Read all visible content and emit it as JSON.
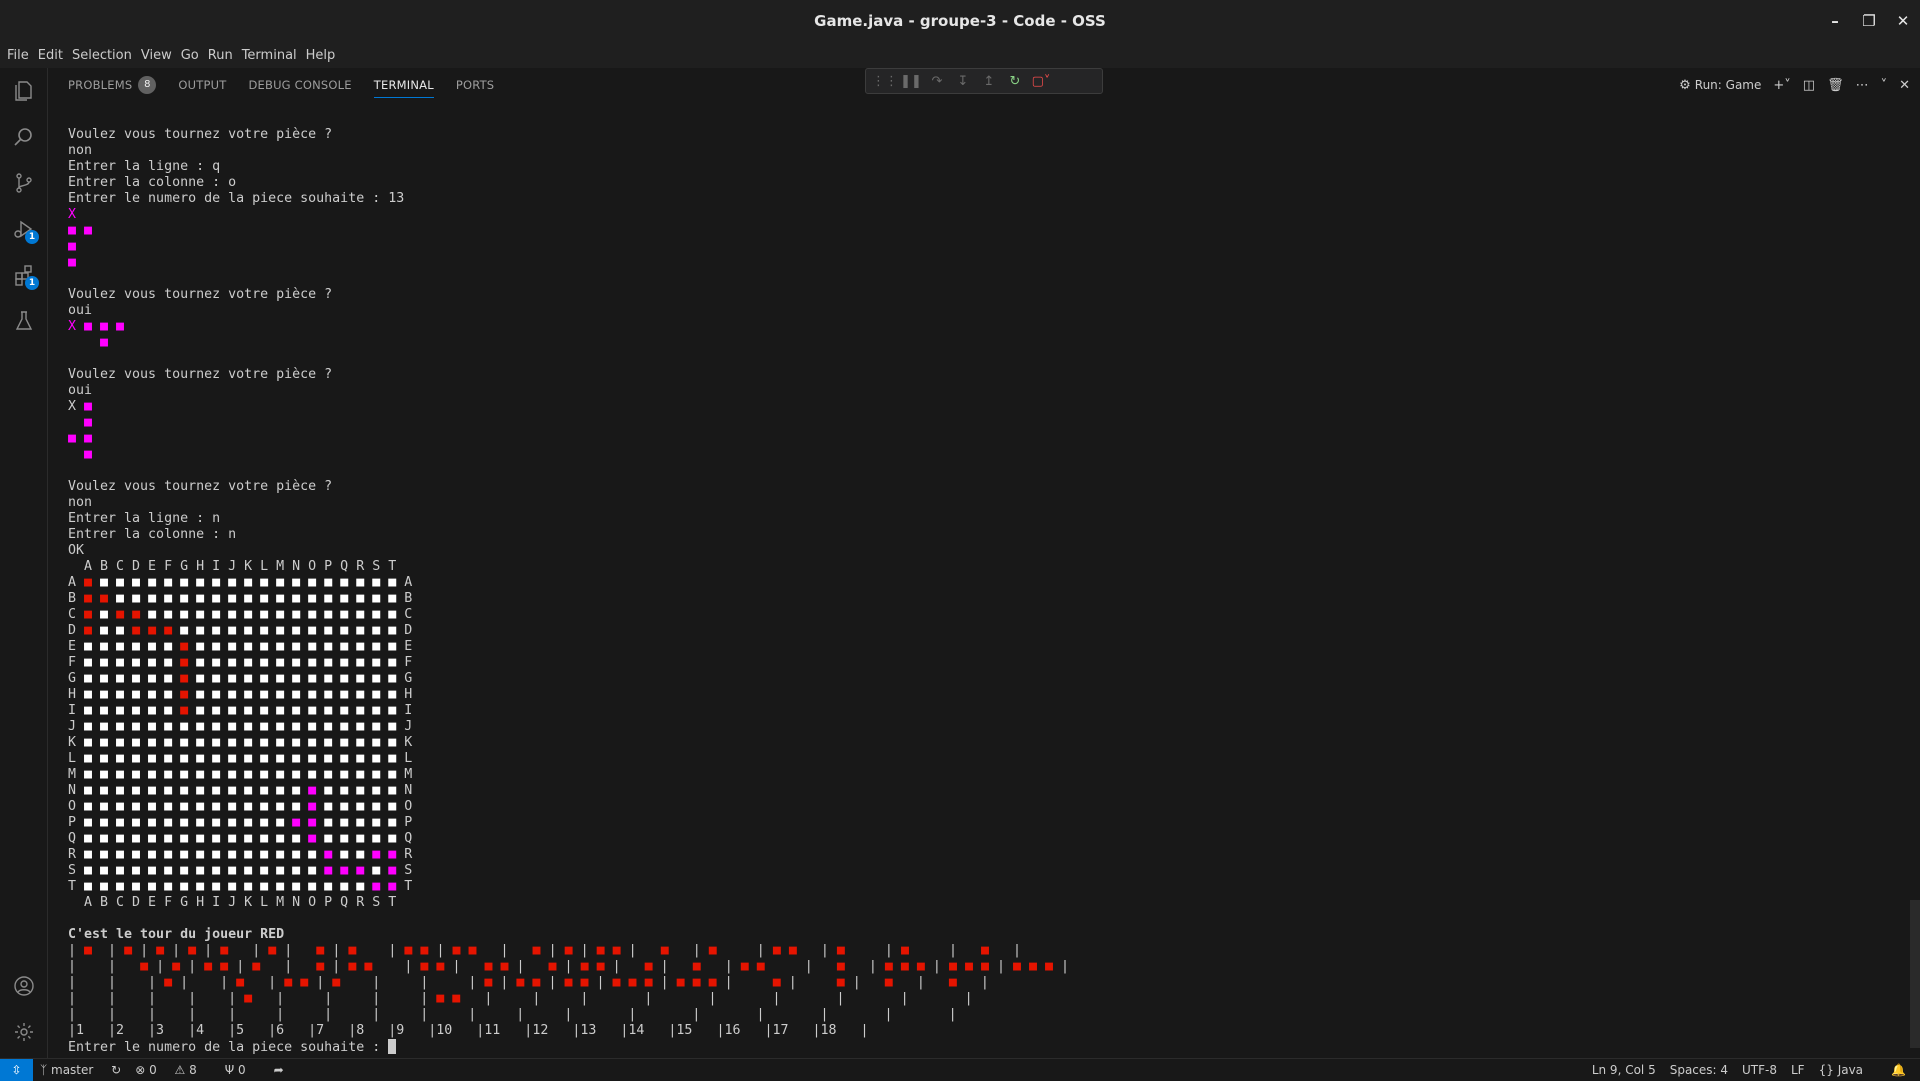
{
  "window": {
    "title": "Game.java - groupe-3 - Code - OSS"
  },
  "menu": [
    "File",
    "Edit",
    "Selection",
    "View",
    "Go",
    "Run",
    "Terminal",
    "Help"
  ],
  "activity_badges": {
    "run_debug": "1",
    "extensions": "1"
  },
  "panel": {
    "tabs": [
      {
        "label": "PROBLEMS",
        "count": "8"
      },
      {
        "label": "OUTPUT"
      },
      {
        "label": "DEBUG CONSOLE"
      },
      {
        "label": "TERMINAL",
        "active": true
      },
      {
        "label": "PORTS"
      }
    ],
    "run_label": "Run: Game"
  },
  "terminal": {
    "prompt_continue": "Entrer le numero de la piece souhaite : ",
    "lines": [
      [
        [
          "Voulez vous tournez votre pièce ?",
          ""
        ]
      ],
      [
        [
          "non",
          ""
        ]
      ],
      [
        [
          "Entrer la ligne : q",
          ""
        ]
      ],
      [
        [
          "Entrer la colonne : o",
          ""
        ]
      ],
      [
        [
          "Entrer le numero de la piece souhaite : 13",
          ""
        ]
      ],
      [
        [
          "X",
          "m"
        ]
      ],
      [
        [
          "■ ■",
          "m"
        ]
      ],
      [
        [
          "■",
          "m"
        ]
      ],
      [
        [
          "■",
          "m"
        ]
      ],
      [
        [
          "",
          ""
        ]
      ],
      [
        [
          "Voulez vous tournez votre pièce ?",
          ""
        ]
      ],
      [
        [
          "oui",
          ""
        ]
      ],
      [
        [
          "X ■ ■ ■",
          "m"
        ]
      ],
      [
        [
          "    ■",
          "m"
        ]
      ],
      [
        [
          "",
          ""
        ]
      ],
      [
        [
          "Voulez vous tournez votre pièce ?",
          ""
        ]
      ],
      [
        [
          "oui",
          ""
        ]
      ],
      [
        [
          "X ",
          ""
        ],
        [
          "■",
          "m"
        ]
      ],
      [
        [
          "  ■",
          "m"
        ]
      ],
      [
        [
          "■ ■",
          "m"
        ]
      ],
      [
        [
          "  ■",
          "m"
        ]
      ],
      [
        [
          "",
          ""
        ]
      ],
      [
        [
          "Voulez vous tournez votre pièce ?",
          ""
        ]
      ],
      [
        [
          "non",
          ""
        ]
      ],
      [
        [
          "Entrer la ligne : n",
          ""
        ]
      ],
      [
        [
          "Entrer la colonne : n",
          ""
        ]
      ],
      [
        [
          "OK",
          ""
        ]
      ],
      [
        [
          "  A B C D E F G H I J K L M N O P Q R S T",
          ""
        ]
      ],
      [
        [
          "A ",
          ""
        ],
        [
          "■",
          "r"
        ],
        [
          " ■ ■ ■ ■ ■ ■ ■ ■ ■ ■ ■ ■ ■ ■ ■ ■ ■ ■ ■",
          "w"
        ],
        [
          " A",
          ""
        ]
      ],
      [
        [
          "B ",
          ""
        ],
        [
          "■ ■",
          "r"
        ],
        [
          " ■ ■ ■ ■ ■ ■ ■ ■ ■ ■ ■ ■ ■ ■ ■ ■ ■ ■",
          "w"
        ],
        [
          " B",
          ""
        ]
      ],
      [
        [
          "C ",
          ""
        ],
        [
          "■",
          "r"
        ],
        [
          " ■ ",
          "w"
        ],
        [
          "■ ■",
          "r"
        ],
        [
          " ■ ■ ■ ■ ■ ■ ■ ■ ■ ■ ■ ■ ■ ■ ■ ■",
          "w"
        ],
        [
          " C",
          ""
        ]
      ],
      [
        [
          "D ",
          ""
        ],
        [
          "■",
          "r"
        ],
        [
          " ■ ■ ",
          "w"
        ],
        [
          "■ ■ ■",
          "r"
        ],
        [
          " ■ ■ ■ ■ ■ ■ ■ ■ ■ ■ ■ ■ ■ ■",
          "w"
        ],
        [
          " D",
          ""
        ]
      ],
      [
        [
          "E ",
          ""
        ],
        [
          "■ ■ ■ ■ ■ ■ ",
          "w"
        ],
        [
          "■",
          "r"
        ],
        [
          " ■ ■ ■ ■ ■ ■ ■ ■ ■ ■ ■ ■ ■",
          "w"
        ],
        [
          " E",
          ""
        ]
      ],
      [
        [
          "F ",
          ""
        ],
        [
          "■ ■ ■ ■ ■ ■ ",
          "w"
        ],
        [
          "■",
          "r"
        ],
        [
          " ■ ■ ■ ■ ■ ■ ■ ■ ■ ■ ■ ■ ■",
          "w"
        ],
        [
          " F",
          ""
        ]
      ],
      [
        [
          "G ",
          ""
        ],
        [
          "■ ■ ■ ■ ■ ■ ",
          "w"
        ],
        [
          "■",
          "r"
        ],
        [
          " ■ ■ ■ ■ ■ ■ ■ ■ ■ ■ ■ ■ ■",
          "w"
        ],
        [
          " G",
          ""
        ]
      ],
      [
        [
          "H ",
          ""
        ],
        [
          "■ ■ ■ ■ ■ ■ ",
          "w"
        ],
        [
          "■",
          "r"
        ],
        [
          " ■ ■ ■ ■ ■ ■ ■ ■ ■ ■ ■ ■ ■",
          "w"
        ],
        [
          " H",
          ""
        ]
      ],
      [
        [
          "I ",
          ""
        ],
        [
          "■ ■ ■ ■ ■ ■ ",
          "w"
        ],
        [
          "■",
          "r"
        ],
        [
          " ■ ■ ■ ■ ■ ■ ■ ■ ■ ■ ■ ■ ■",
          "w"
        ],
        [
          " I",
          ""
        ]
      ],
      [
        [
          "J ",
          ""
        ],
        [
          "■ ■ ■ ■ ■ ■ ■ ■ ■ ■ ■ ■ ■ ■ ■ ■ ■ ■ ■ ■",
          "w"
        ],
        [
          " J",
          ""
        ]
      ],
      [
        [
          "K ",
          ""
        ],
        [
          "■ ■ ■ ■ ■ ■ ■ ■ ■ ■ ■ ■ ■ ■ ■ ■ ■ ■ ■ ■",
          "w"
        ],
        [
          " K",
          ""
        ]
      ],
      [
        [
          "L ",
          ""
        ],
        [
          "■ ■ ■ ■ ■ ■ ■ ■ ■ ■ ■ ■ ■ ■ ■ ■ ■ ■ ■ ■",
          "w"
        ],
        [
          " L",
          ""
        ]
      ],
      [
        [
          "M ",
          ""
        ],
        [
          "■ ■ ■ ■ ■ ■ ■ ■ ■ ■ ■ ■ ■ ■ ■ ■ ■ ■ ■ ■",
          "w"
        ],
        [
          " M",
          ""
        ]
      ],
      [
        [
          "N ",
          ""
        ],
        [
          "■ ■ ■ ■ ■ ■ ■ ■ ■ ■ ■ ■ ■ ■ ",
          "w"
        ],
        [
          "■",
          "m"
        ],
        [
          " ■ ■ ■ ■ ■",
          "w"
        ],
        [
          " N",
          ""
        ]
      ],
      [
        [
          "O ",
          ""
        ],
        [
          "■ ■ ■ ■ ■ ■ ■ ■ ■ ■ ■ ■ ■ ■ ",
          "w"
        ],
        [
          "■",
          "m"
        ],
        [
          " ■ ■ ■ ■ ■",
          "w"
        ],
        [
          " O",
          ""
        ]
      ],
      [
        [
          "P ",
          ""
        ],
        [
          "■ ■ ■ ■ ■ ■ ■ ■ ■ ■ ■ ■ ■ ",
          "w"
        ],
        [
          "■ ■",
          "m"
        ],
        [
          " ■ ■ ■ ■ ■",
          "w"
        ],
        [
          " P",
          ""
        ]
      ],
      [
        [
          "Q ",
          ""
        ],
        [
          "■ ■ ■ ■ ■ ■ ■ ■ ■ ■ ■ ■ ■ ■ ",
          "w"
        ],
        [
          "■",
          "m"
        ],
        [
          " ■ ■ ■ ■ ■",
          "w"
        ],
        [
          " Q",
          ""
        ]
      ],
      [
        [
          "R ",
          ""
        ],
        [
          "■ ■ ■ ■ ■ ■ ■ ■ ■ ■ ■ ■ ■ ■ ■ ",
          "w"
        ],
        [
          "■",
          "m"
        ],
        [
          " ■ ■ ",
          "w"
        ],
        [
          "■ ■",
          "m"
        ],
        [
          " R",
          ""
        ]
      ],
      [
        [
          "S ",
          ""
        ],
        [
          "■ ■ ■ ■ ■ ■ ■ ■ ■ ■ ■ ■ ■ ■ ■ ",
          "w"
        ],
        [
          "■ ■ ■",
          "m"
        ],
        [
          " ■ ",
          "w"
        ],
        [
          "■",
          "m"
        ],
        [
          " S",
          ""
        ]
      ],
      [
        [
          "T ",
          ""
        ],
        [
          "■ ■ ■ ■ ■ ■ ■ ■ ■ ■ ■ ■ ■ ■ ■ ■ ■ ■ ",
          "w"
        ],
        [
          "■ ■",
          "m"
        ],
        [
          " T",
          ""
        ]
      ],
      [
        [
          "  A B C D E F G H I J K L M N O P Q R S T",
          ""
        ]
      ],
      [
        [
          "",
          ""
        ]
      ],
      [
        [
          "C'est le tour du joueur RED",
          "b"
        ]
      ],
      [
        [
          "| ",
          ""
        ],
        [
          "■",
          "r"
        ],
        [
          "  | ",
          ""
        ],
        [
          "■",
          "r"
        ],
        [
          " | ",
          ""
        ],
        [
          "■",
          "r"
        ],
        [
          " | ",
          ""
        ],
        [
          "■",
          "r"
        ],
        [
          " | ",
          ""
        ],
        [
          "■",
          "r"
        ],
        [
          "   | ",
          ""
        ],
        [
          "■",
          "r"
        ],
        [
          " |   ",
          ""
        ],
        [
          "■",
          "r"
        ],
        [
          " | ",
          ""
        ],
        [
          "■",
          "r"
        ],
        [
          "    | ",
          ""
        ],
        [
          "■ ■",
          "r"
        ],
        [
          " | ",
          ""
        ],
        [
          "■ ■",
          "r"
        ],
        [
          "   |   ",
          ""
        ],
        [
          "■",
          "r"
        ],
        [
          " | ",
          ""
        ],
        [
          "■",
          "r"
        ],
        [
          " | ",
          ""
        ],
        [
          "■ ■",
          "r"
        ],
        [
          " |   ",
          ""
        ],
        [
          "■",
          "r"
        ],
        [
          "   | ",
          ""
        ],
        [
          "■",
          "r"
        ],
        [
          "     | ",
          ""
        ],
        [
          "■ ■",
          "r"
        ],
        [
          "   | ",
          ""
        ],
        [
          "■",
          "r"
        ],
        [
          "     | ",
          ""
        ],
        [
          "■",
          "r"
        ],
        [
          "     |   ",
          ""
        ],
        [
          "■",
          "r"
        ],
        [
          "   |",
          ""
        ]
      ],
      [
        [
          "|    |   ",
          ""
        ],
        [
          "■",
          "r"
        ],
        [
          " | ",
          ""
        ],
        [
          "■",
          "r"
        ],
        [
          " | ",
          ""
        ],
        [
          "■ ■",
          "r"
        ],
        [
          " | ",
          ""
        ],
        [
          "■",
          "r"
        ],
        [
          "   |   ",
          ""
        ],
        [
          "■",
          "r"
        ],
        [
          " | ",
          ""
        ],
        [
          "■ ■",
          "r"
        ],
        [
          "    | ",
          ""
        ],
        [
          "■ ■",
          "r"
        ],
        [
          " |   ",
          ""
        ],
        [
          "■ ■",
          "r"
        ],
        [
          " |   ",
          ""
        ],
        [
          "■",
          "r"
        ],
        [
          " | ",
          ""
        ],
        [
          "■ ■",
          "r"
        ],
        [
          " |   ",
          ""
        ],
        [
          "■",
          "r"
        ],
        [
          " |   ",
          ""
        ],
        [
          "■",
          "r"
        ],
        [
          "   | ",
          ""
        ],
        [
          "■ ■",
          "r"
        ],
        [
          "     |   ",
          ""
        ],
        [
          "■",
          "r"
        ],
        [
          "   | ",
          ""
        ],
        [
          "■ ■ ■",
          "r"
        ],
        [
          " | ",
          ""
        ],
        [
          "■ ■ ■",
          "r"
        ],
        [
          " | ",
          ""
        ],
        [
          "■ ■ ■",
          "r"
        ],
        [
          " |",
          ""
        ]
      ],
      [
        [
          "|    |    | ",
          ""
        ],
        [
          "■",
          "r"
        ],
        [
          " |    | ",
          ""
        ],
        [
          "■",
          "r"
        ],
        [
          "   | ",
          ""
        ],
        [
          "■ ■",
          "r"
        ],
        [
          " | ",
          ""
        ],
        [
          "■",
          "r"
        ],
        [
          "    |     |     | ",
          ""
        ],
        [
          "■",
          "r"
        ],
        [
          " | ",
          ""
        ],
        [
          "■ ■",
          "r"
        ],
        [
          " | ",
          ""
        ],
        [
          "■ ■",
          "r"
        ],
        [
          " | ",
          ""
        ],
        [
          "■ ■ ■",
          "r"
        ],
        [
          " | ",
          ""
        ],
        [
          "■ ■ ■",
          "r"
        ],
        [
          " |     ",
          ""
        ],
        [
          "■",
          "r"
        ],
        [
          " |     ",
          ""
        ],
        [
          "■",
          "r"
        ],
        [
          " |   ",
          ""
        ],
        [
          "■",
          "r"
        ],
        [
          "   |   ",
          ""
        ],
        [
          "■",
          "r"
        ],
        [
          "   |",
          ""
        ]
      ],
      [
        [
          "|    |    |    |    | ",
          ""
        ],
        [
          "■",
          "r"
        ],
        [
          "   |     |     |     | ",
          ""
        ],
        [
          "■ ■",
          "r"
        ],
        [
          "   |     |     |       |       |       |       |       |       |",
          ""
        ]
      ],
      [
        [
          "|    |    |    |    |     |     |     |     |     |     |     |       |       |       |       |       |       |",
          ""
        ]
      ],
      [
        [
          "|1   |2   |3   |4   |5   |6   |7   |8   |9   |10   |11   |12   |13   |14   |15   |16   |17   |18   |",
          ""
        ]
      ]
    ]
  },
  "status": {
    "branch": "master",
    "errors": "0",
    "warnings": "8",
    "ports": "0",
    "cursor_pos": "Ln 9, Col 5",
    "spaces": "Spaces: 4",
    "encoding": "UTF-8",
    "eol": "LF",
    "language": "Java"
  }
}
